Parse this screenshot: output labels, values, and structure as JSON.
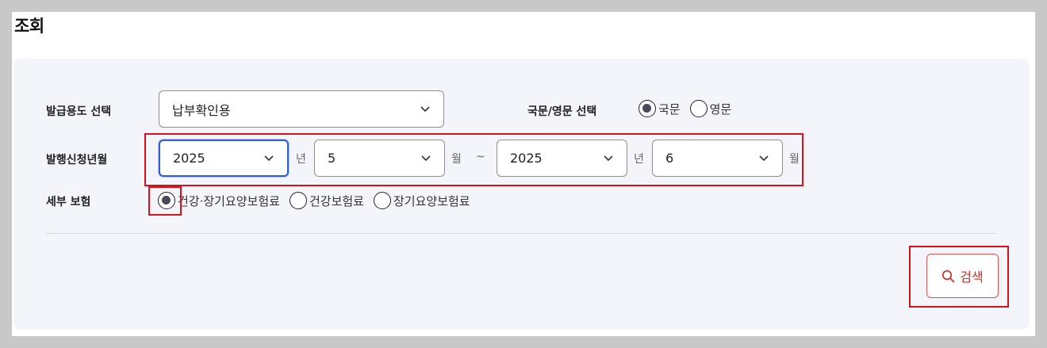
{
  "page": {
    "title": "조회"
  },
  "form": {
    "purpose": {
      "label": "발급용도 선택",
      "value": "납부확인용"
    },
    "language": {
      "label": "국문/영문 선택",
      "options": [
        {
          "label": "국문",
          "checked": true
        },
        {
          "label": "영문",
          "checked": false
        }
      ]
    },
    "period": {
      "label": "발행신청년월",
      "start_year": "2025",
      "start_month": "5",
      "end_year": "2025",
      "end_month": "6",
      "year_unit": "년",
      "month_unit": "월",
      "separator": "~"
    },
    "insurance": {
      "label": "세부 보험",
      "options": [
        {
          "label": "건강·장기요양보험료",
          "checked": true
        },
        {
          "label": "건강보험료",
          "checked": false
        },
        {
          "label": "장기요양보험료",
          "checked": false
        }
      ]
    }
  },
  "actions": {
    "search_label": "검색"
  },
  "colors": {
    "accent": "#2f5fd0",
    "highlight": "#d8121a",
    "search": "#c7302b",
    "panel": "#f4f5fa"
  },
  "icons": {
    "search": "search-icon",
    "dropdown": "chevron-down-icon"
  }
}
